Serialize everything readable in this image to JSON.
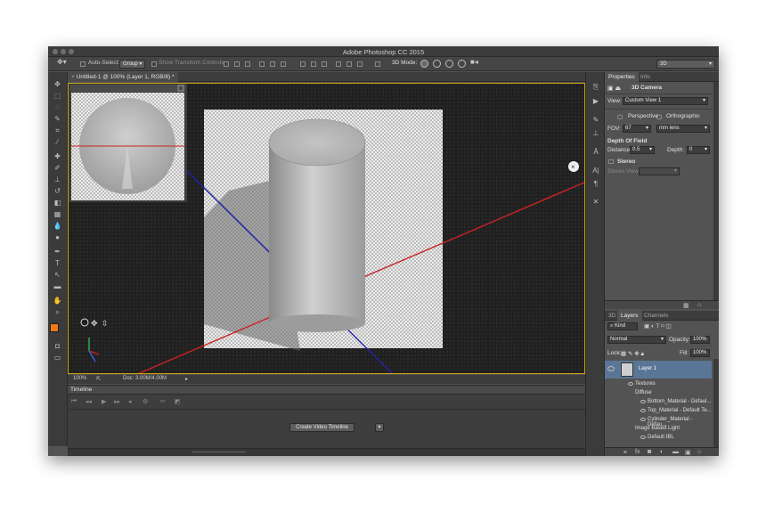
{
  "window": {
    "title": "Adobe Photoshop CC 2015"
  },
  "options_bar": {
    "auto_select_label": "Auto-Select:",
    "auto_select_value": "Group",
    "show_transform_label": "Show Transform Controls",
    "mode_label": "3D Mode:",
    "workspace_value": "3D"
  },
  "document": {
    "tab_label": "Untitled-1 @ 100% (Layer 1, RGB/8) *",
    "zoom": "100%",
    "doc_info": "Doc: 3.00M/4.00M"
  },
  "timeline": {
    "title": "Timeline",
    "create_button": "Create Video Timeline"
  },
  "properties": {
    "tabs": [
      "Properties",
      "Info"
    ],
    "header": "3D Camera",
    "view_label": "View:",
    "view_value": "Custom View 1",
    "perspective_label": "Perspective",
    "orthographic_label": "Orthographic",
    "fov_label": "FOV:",
    "fov_value": "67",
    "fov_unit": "mm lens",
    "dof_label": "Depth Of Field",
    "distance_label": "Distance:",
    "distance_value": "0.5",
    "depth_label": "Depth:",
    "depth_value": "0",
    "stereo_label": "Stereo",
    "stereo_view_label": "Stereo View:"
  },
  "layers_panel": {
    "tabs": [
      "3D",
      "Layers",
      "Channels"
    ],
    "filter_value": "Kind",
    "blend_mode": "Normal",
    "opacity_label": "Opacity:",
    "opacity_value": "100%",
    "lock_label": "Lock:",
    "fill_label": "Fill:",
    "fill_value": "100%",
    "layer_name": "Layer 1",
    "items": [
      {
        "label": "Textures"
      },
      {
        "label": "Diffuse"
      },
      {
        "label": "Bottom_Material - Defaul..."
      },
      {
        "label": "Top_Material - Default Te..."
      },
      {
        "label": "Cylinder_Material - Defau..."
      },
      {
        "label": "Image Based Light"
      },
      {
        "label": "Default IBL"
      }
    ]
  },
  "colors": {
    "foreground": "#f07a18",
    "background": "#ffffff",
    "selected_layer": "#5a7696"
  }
}
